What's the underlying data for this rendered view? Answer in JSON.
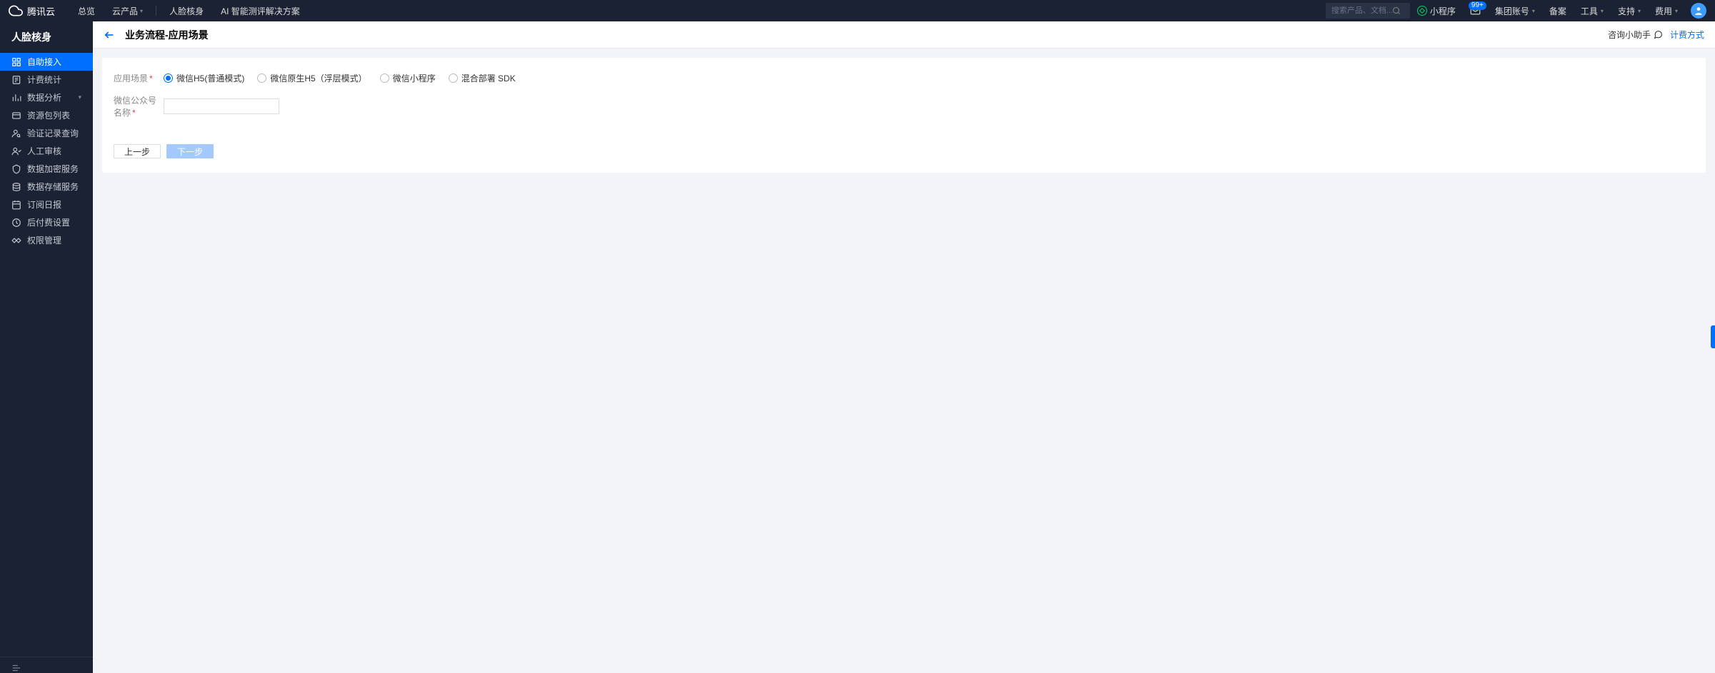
{
  "header": {
    "brand": "腾讯云",
    "nav_left": [
      "总览",
      "云产品"
    ],
    "nav_secondary": [
      "人脸核身",
      "AI 智能测评解决方案"
    ],
    "search_placeholder": "搜索产品、文档...",
    "mini_program": "小程序",
    "badge": "99+",
    "account": "集团账号",
    "beian": "备案",
    "tools": "工具",
    "support": "支持",
    "fee": "费用"
  },
  "sidebar": {
    "title": "人脸核身",
    "items": [
      {
        "label": "自助接入",
        "active": true
      },
      {
        "label": "计费统计"
      },
      {
        "label": "数据分析",
        "expandable": true
      },
      {
        "label": "资源包列表"
      },
      {
        "label": "验证记录查询"
      },
      {
        "label": "人工审核"
      },
      {
        "label": "数据加密服务"
      },
      {
        "label": "数据存储服务"
      },
      {
        "label": "订阅日报"
      },
      {
        "label": "后付费设置"
      },
      {
        "label": "权限管理"
      }
    ]
  },
  "page": {
    "title": "业务流程-应用场景",
    "assist": "咨询小助手",
    "billing_link": "计费方式"
  },
  "form": {
    "scene_label": "应用场景",
    "radios": [
      "微信H5(普通模式)",
      "微信原生H5（浮层模式）",
      "微信小程序",
      "混合部署 SDK"
    ],
    "account_label": "微信公众号名称",
    "prev": "上一步",
    "next": "下一步"
  }
}
